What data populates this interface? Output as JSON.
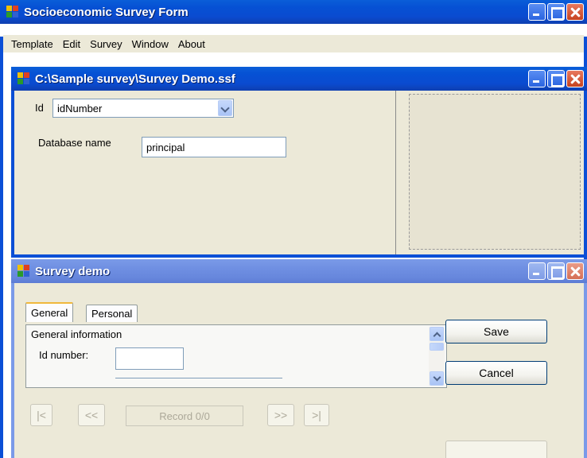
{
  "app": {
    "title": "Socioeconomic Survey Form",
    "menu": [
      "Template",
      "Edit",
      "Survey",
      "Window",
      "About"
    ]
  },
  "survey_window": {
    "title": "C:\\Sample survey\\Survey Demo.ssf",
    "id_label": "Id",
    "id_select_value": "idNumber",
    "db_label": "Database name",
    "db_value": "principal"
  },
  "demo_window": {
    "title": "Survey demo",
    "tabs": [
      "General",
      "Personal"
    ],
    "active_tab": "General",
    "section_heading": "General information",
    "id_number_label": "Id number:",
    "id_number_value": "",
    "save_label": "Save",
    "cancel_label": "Cancel",
    "nav": {
      "first": "|<",
      "prev": "<<",
      "record": "Record 0/0",
      "next": ">>",
      "last": ">|"
    }
  },
  "colors": {
    "title_active": "#0a5ed8",
    "title_inactive": "#7a9ae8",
    "face": "#ece9d8",
    "close_button": "#c6421f"
  },
  "icons": [
    "app-icon",
    "minimize-icon",
    "maximize-icon",
    "close-icon",
    "scroll-up-icon",
    "scroll-down-icon",
    "dropdown-arrow-icon"
  ]
}
